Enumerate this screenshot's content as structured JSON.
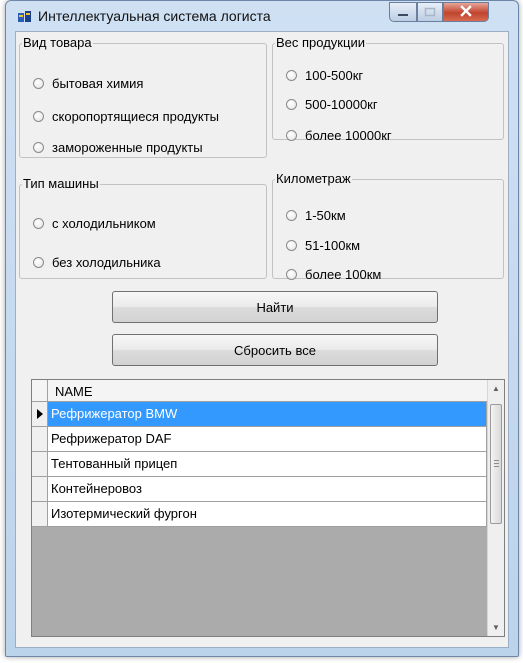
{
  "window": {
    "title": "Интеллектуальная система логиста",
    "icons": {
      "app": "app-icon",
      "minimize": "minimize-icon",
      "maximize": "maximize-icon",
      "close": "close-icon"
    }
  },
  "groups": {
    "product_type": {
      "label": "Вид товара",
      "options": [
        "бытовая химия",
        "скоропортящиеся продукты",
        "замороженные продукты"
      ]
    },
    "weight": {
      "label": "Вес продукции",
      "options": [
        "100-500кг",
        "500-10000кг",
        "более 10000кг"
      ]
    },
    "vehicle": {
      "label": "Тип машины",
      "options": [
        "с холодильником",
        "без холодильника"
      ]
    },
    "distance": {
      "label": "Километраж",
      "options": [
        "1-50км",
        "51-100км",
        "более 100км"
      ]
    }
  },
  "buttons": {
    "find": "Найти",
    "reset": "Сбросить все"
  },
  "grid": {
    "column": "NAME",
    "rows": [
      "Рефрижератор BMW",
      "Рефрижератор DAF",
      "Тентованный прицеп",
      "Контейнеровоз",
      "Изотермический фургон"
    ],
    "selected_index": 0
  },
  "colors": {
    "selection": "#3399ff",
    "window_frame": "#bcd3ec",
    "close_button": "#c0442d"
  }
}
